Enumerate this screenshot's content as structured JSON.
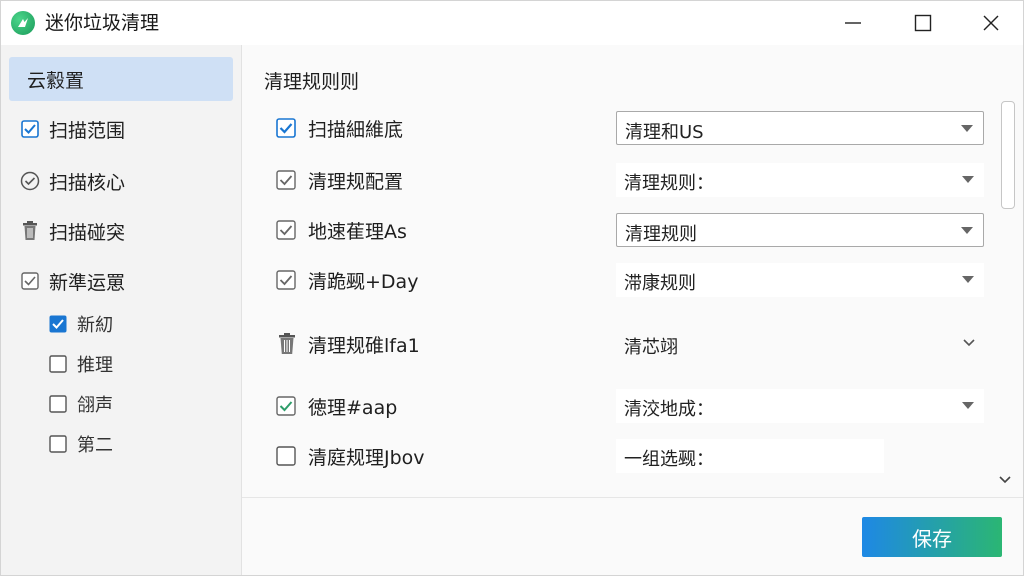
{
  "window": {
    "title": "迷你垃圾清理"
  },
  "sidebar": {
    "items": [
      {
        "label": "云縠置",
        "icon": "none",
        "active": true
      },
      {
        "label": "扫描范围",
        "icon": "checkbox-checked-icon"
      },
      {
        "label": "扫描核心",
        "icon": "check-circle-icon"
      },
      {
        "label": "扫描碰突",
        "icon": "trash-icon"
      },
      {
        "label": "新準运罳",
        "icon": "checkbox-outline-icon"
      }
    ],
    "subitems": [
      {
        "label": "新糿",
        "checked": true
      },
      {
        "label": "推理",
        "checked": false
      },
      {
        "label": "翖声",
        "checked": false
      },
      {
        "label": "第二",
        "checked": false
      }
    ]
  },
  "main": {
    "section_title": "清理规则则",
    "rows": [
      {
        "label": "扫描細維底",
        "checkbox": "checked-blue",
        "select_value": "清理和US",
        "select_style": "boxed",
        "arrow": "triangle"
      },
      {
        "label": "清理规配置",
        "checkbox": "checked-outline",
        "select_value": "清理规则：",
        "select_style": "plain",
        "arrow": "triangle"
      },
      {
        "label": "地速萑理As",
        "checkbox": "checked-outline",
        "select_value": "清理规则",
        "select_style": "boxed",
        "arrow": "triangle"
      },
      {
        "label": "清跪觋+Day",
        "checkbox": "checked-outline",
        "select_value": "滞康规则",
        "select_style": "plain",
        "arrow": "triangle"
      },
      {
        "label": "清理规碓lfa1",
        "checkbox": "trash",
        "select_value": "清芯翊",
        "select_style": "none",
        "arrow": "chevron"
      },
      {
        "label": "徳理#aap",
        "checkbox": "checked-green",
        "select_value": "清洨地成：",
        "select_style": "plain",
        "arrow": "triangle"
      },
      {
        "label": "清庭规理Jbov",
        "checkbox": "unchecked",
        "select_value": "一组选觋：",
        "select_style": "plain-short",
        "arrow": "none"
      }
    ],
    "save_label": "保存"
  }
}
